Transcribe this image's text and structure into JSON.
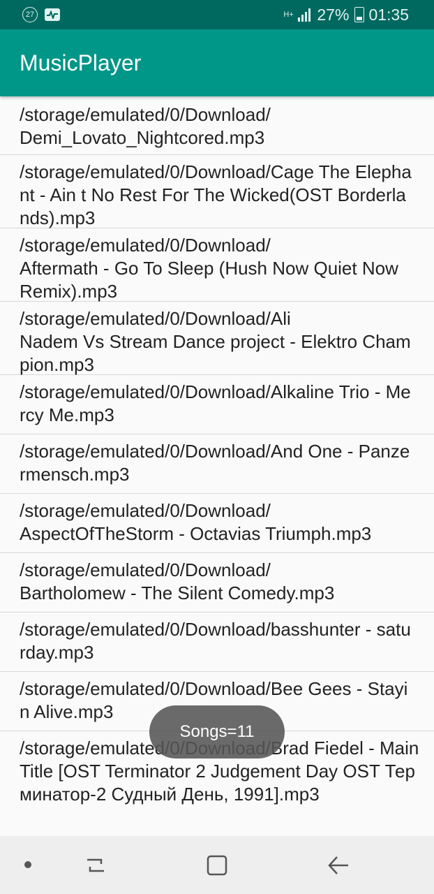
{
  "status_bar": {
    "notification_badge": "27",
    "network_type": "H+",
    "battery": "27%",
    "time": "01:35",
    "icons": [
      "notification-count-icon",
      "activity-pulse-icon",
      "hplus-network-icon",
      "signal-bars-icon",
      "battery-icon"
    ]
  },
  "app": {
    "title": "MusicPlayer",
    "colors": {
      "primary": "#009688",
      "primary_dark": "#00695f"
    }
  },
  "songs": [
    "/storage/emulated/0/Download/\nDemi_Lovato_Nightcored.mp3",
    "/storage/emulated/0/Download/Cage The Elephant - Ain t No Rest For The Wicked(OST Borderlands).mp3",
    "/storage/emulated/0/Download/\nAftermath - Go To Sleep (Hush Now Quiet Now Remix).mp3",
    "/storage/emulated/0/Download/Ali\nNadem Vs Stream Dance project - Elektro Champion.mp3",
    "/storage/emulated/0/Download/Alkaline Trio - Mercy Me.mp3",
    "/storage/emulated/0/Download/And One - Panzermensch.mp3",
    "/storage/emulated/0/Download/\nAspectOfTheStorm - Octavias Triumph.mp3",
    "/storage/emulated/0/Download/\nBartholomew - The Silent Comedy.mp3",
    "/storage/emulated/0/Download/basshunter - saturday.mp3",
    "/storage/emulated/0/Download/Bee Gees - Stayin Alive.mp3",
    "/storage/emulated/0/Download/Brad Fiedel - Main Title [OST Terminator 2 Judgement Day OST Терминатор-2 Судный День, 1991].mp3"
  ],
  "toast": "Songs=11",
  "nav_bar": {
    "icons": [
      "nav-dot-icon",
      "recent-apps-icon",
      "home-icon",
      "back-icon"
    ]
  }
}
